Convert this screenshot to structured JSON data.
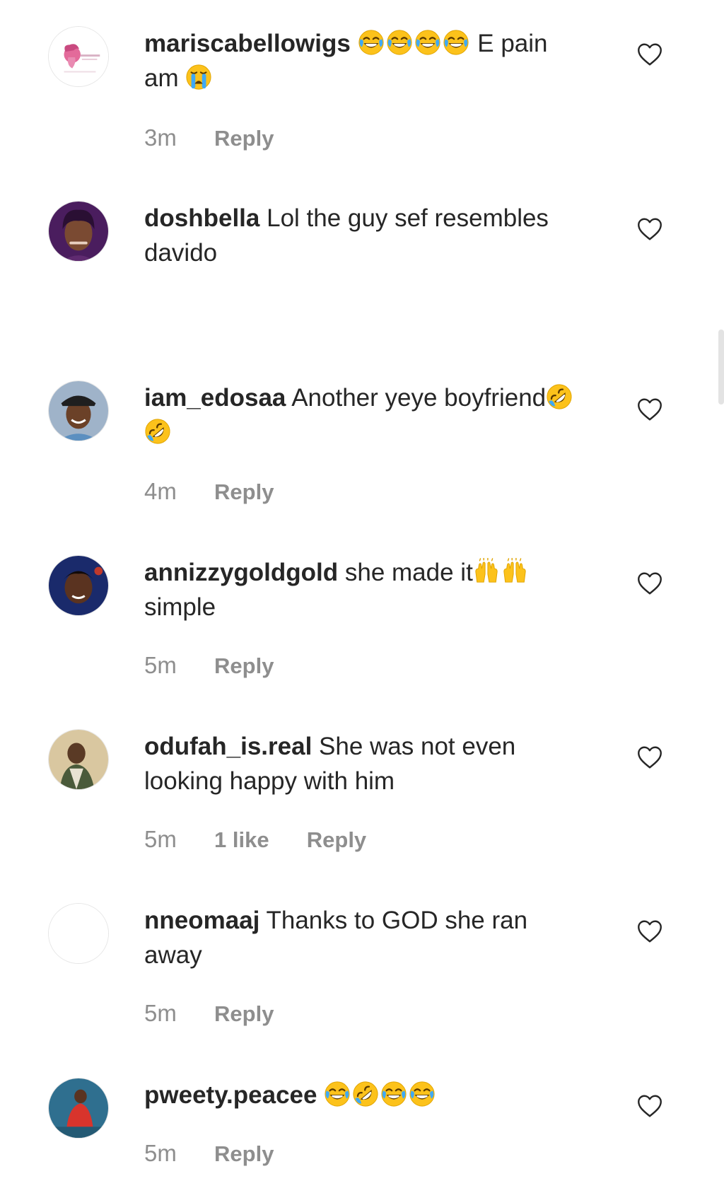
{
  "comments": [
    {
      "username": "mariscabellowigs",
      "text": "E pain",
      "text2": "am",
      "time": "3m",
      "reply": "Reply",
      "emojis_before_text": [
        "tears-of-joy-emoji",
        "tears-of-joy-emoji",
        "tears-of-joy-emoji",
        "tears-of-joy-emoji"
      ],
      "emoji_after_text2": "crying-face-emoji"
    },
    {
      "username": "doshbella",
      "text": "Lol the guy sef resembles",
      "text2": "davido"
    },
    {
      "username": "iam_edosaa",
      "text": "Another yeye boyfriend",
      "time": "4m",
      "reply": "Reply",
      "emojis": [
        "rolling-on-floor-laughing-emoji",
        "rolling-on-floor-laughing-emoji"
      ]
    },
    {
      "username": "annizzygoldgold",
      "text": "she made it",
      "text2": "simple",
      "time": "5m",
      "reply": "Reply",
      "emojis": [
        "raising-hands-emoji",
        "raising-hands-emoji"
      ]
    },
    {
      "username": "odufah_is.real",
      "text": "She was not even",
      "text2": "looking happy with him",
      "time": "5m",
      "likes": "1 like",
      "reply": "Reply"
    },
    {
      "username": "nneomaaj",
      "text": "Thanks to GOD she ran",
      "text2": "away",
      "time": "5m",
      "reply": "Reply"
    },
    {
      "username": "pweety.peacee",
      "time": "5m",
      "reply": "Reply",
      "emojis": [
        "tears-of-joy-emoji",
        "rolling-on-floor-laughing-emoji",
        "tears-of-joy-emoji",
        "tears-of-joy-emoji"
      ]
    }
  ],
  "icons": {
    "like": "heart-outline-icon"
  },
  "colors": {
    "text": "#262626",
    "meta": "#8e8e8e",
    "emoji_yellow": "#fcc21b"
  }
}
